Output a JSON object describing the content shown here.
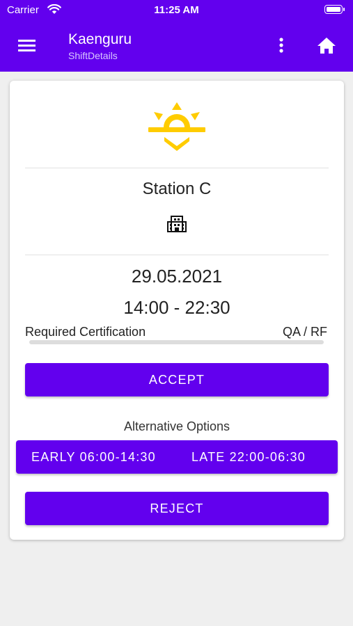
{
  "status_bar": {
    "carrier": "Carrier",
    "time": "11:25 AM"
  },
  "app_bar": {
    "title": "Kaenguru",
    "subtitle": "ShiftDetails",
    "menu_icon": "hamburger-menu-icon",
    "more_icon": "more-vert-icon",
    "home_icon": "home-icon",
    "color": "#6200ee"
  },
  "shift": {
    "icon": "sunrise-icon",
    "icon_color": "#ffcc00",
    "station": "Station C",
    "location_icon": "building-icon",
    "date": "29.05.2021",
    "time": "14:00 - 22:30",
    "required_cert_label": "Required Certification",
    "required_cert_value": "QA / RF"
  },
  "actions": {
    "accept_label": "ACCEPT",
    "alternatives_label": "Alternative Options",
    "alternatives": [
      {
        "label": "EARLY 06:00-14:30"
      },
      {
        "label": "LATE 22:00-06:30"
      }
    ],
    "reject_label": "REJECT"
  }
}
